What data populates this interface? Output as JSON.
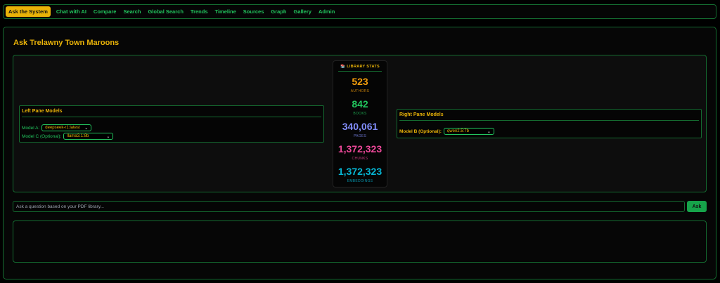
{
  "nav": {
    "items": [
      {
        "label": "Ask the System",
        "active": true
      },
      {
        "label": "Chat with AI",
        "active": false
      },
      {
        "label": "Compare",
        "active": false
      },
      {
        "label": "Search",
        "active": false
      },
      {
        "label": "Global Search",
        "active": false
      },
      {
        "label": "Trends",
        "active": false
      },
      {
        "label": "Timeline",
        "active": false
      },
      {
        "label": "Sources",
        "active": false
      },
      {
        "label": "Graph",
        "active": false
      },
      {
        "label": "Gallery",
        "active": false
      },
      {
        "label": "Admin",
        "active": false
      }
    ]
  },
  "page": {
    "title": "Ask Trelawny Town Maroons"
  },
  "left_pane": {
    "title": "Left Pane Models",
    "model_a_label": "Model A:",
    "model_a_value": "deepseek-r1:latest",
    "model_c_label": "Model C (Optional):",
    "model_c_value": "llama3.1:8b"
  },
  "right_pane": {
    "title": "Right Pane Models",
    "model_b_label": "Model B (Optional):",
    "model_b_value": "qwen2.5:7b"
  },
  "stats": {
    "title": "LIBRARY STATS",
    "icon": "books-icon",
    "items": [
      {
        "value": "523",
        "label": "AUTHORS",
        "color": "#f59e0b"
      },
      {
        "value": "842",
        "label": "BOOKS",
        "color": "#22c55e"
      },
      {
        "value": "340,061",
        "label": "PAGES",
        "color": "#818cf8"
      },
      {
        "value": "1,372,323",
        "label": "CHUNKS",
        "color": "#ec4899"
      },
      {
        "value": "1,372,323",
        "label": "EMBEDDINGS",
        "color": "#06b6d4"
      }
    ]
  },
  "ask": {
    "placeholder": "Ask a question based on your PDF library...",
    "button_label": "Ask"
  },
  "colors": {
    "accent": "#eab308",
    "primary": "#22c55e",
    "border": "#146b30"
  }
}
